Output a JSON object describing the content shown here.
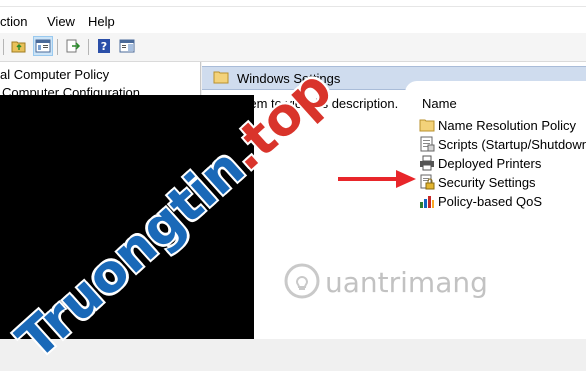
{
  "menu": {
    "action": "Action",
    "action_visible": "ction",
    "view": "View",
    "help": "Help"
  },
  "tree": {
    "items": [
      {
        "label": "al Computer Policy"
      },
      {
        "label": "Computer Configuration"
      }
    ]
  },
  "right_pane": {
    "header_title": "Windows Settings",
    "description": "n item to view its description."
  },
  "list": {
    "column_header": "Name",
    "items": [
      {
        "label": "Name Resolution Policy",
        "icon": "folder-icon"
      },
      {
        "label": "Scripts (Startup/Shutdown)",
        "icon": "scripts-icon"
      },
      {
        "label": "Deployed Printers",
        "icon": "printer-icon"
      },
      {
        "label": "Security Settings",
        "icon": "security-settings-icon"
      },
      {
        "label": "Policy-based QoS",
        "icon": "qos-chart-icon"
      }
    ]
  },
  "watermarks": {
    "diagonal_main": "Truongtin",
    "diagonal_suffix": ".top",
    "bottom": "uantrimang"
  },
  "colors": {
    "header_band": "#cfdcee",
    "arrow": "#e8262a",
    "watermark_blue": "#1a69b8",
    "watermark_red": "#d9342b"
  }
}
